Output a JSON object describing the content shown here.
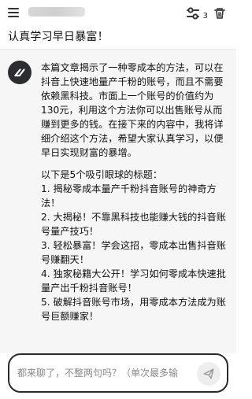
{
  "header": {
    "title": "",
    "selection_count": "3",
    "icons": [
      "hamburger-menu-icon",
      "toggle-icon",
      "trash-icon"
    ]
  },
  "conversation": {
    "user_message": "认真学习早日暴富！",
    "assistant": {
      "paragraph": "本篇文章揭示了一种零成本的方法，可以在抖音上快速地量产千粉的账号，而且不需要依赖黑科技。市面上一个账号的价值约为130元，利用这个方法你可以出售账号从而赚到更多的钱。在接下来的内容中，我将详细介绍这个方法，希望大家认真学习，以便早日实现财富的暴增。",
      "titles_intro": "以下是5个吸引眼球的标题：",
      "titles": [
        "1. 揭秘零成本量产千粉抖音账号的神奇方法！",
        "2. 大揭秘！不靠黑科技也能赚大钱的抖音账号量产技巧！",
        "3. 轻松暴富！学会这招，零成本出售抖音账号赚翻天！",
        "4. 独家秘籍大公开！学习如何零成本快速批量产出千粉抖音账号！",
        "5. 破解抖音账号市场，用零成本方法成为账号巨额赚家！"
      ]
    }
  },
  "input": {
    "placeholder": "都来聊了，不整两句吗？（单次最多输"
  },
  "colors": {
    "assistant_bg": "#f6f6f6",
    "avatar_bg": "#2b2d31",
    "input_border": "#2a2a2a",
    "send_btn_bg": "#eeeeee"
  }
}
